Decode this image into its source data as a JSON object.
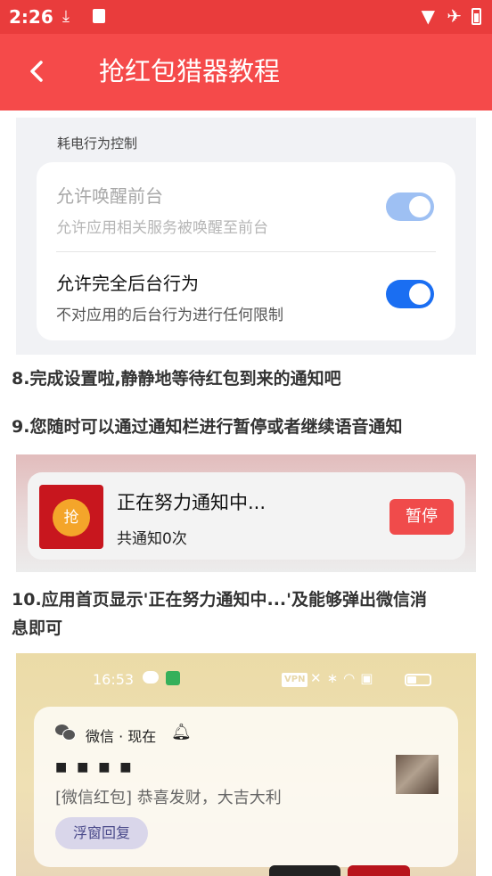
{
  "status_bar": {
    "time": "2:26"
  },
  "app_bar": {
    "title": "抢红包猎器教程"
  },
  "settings_shot": {
    "section_label": "耗电行为控制",
    "rows": [
      {
        "title": "允许唤醒前台",
        "subtitle": "允许应用相关服务被唤醒至前台",
        "enabled": true,
        "dimmed": true
      },
      {
        "title": "允许完全后台行为",
        "subtitle": "不对应用的后台行为进行任何限制",
        "enabled": true,
        "dimmed": false
      }
    ]
  },
  "steps": {
    "s8": "8.完成设置啦,静静地等待红包到来的通知吧",
    "s9": "9.您随时可以通过通知栏进行暂停或者继续语音通知",
    "s10_line1": "10.应用首页显示'正在努力通知中...'及能够弹出微信消",
    "s10_line2": "息即可"
  },
  "notification_shot": {
    "envelope_char": "抢",
    "title": "正在努力通知中...",
    "subtitle": "共通知0次",
    "pause_button": "暂停"
  },
  "wechat_shot": {
    "status_time": "16:53",
    "vpn": "VPN",
    "app_line": "微信 · 现在",
    "sender_masked": "■ ■  ■ ■",
    "message": "[微信红包] 恭喜发财，大吉大利",
    "reply_button": "浮窗回复"
  },
  "colors": {
    "status_bar": "#e93c3c",
    "app_bar": "#f54a4a",
    "toggle_on": "#1a6ef2",
    "pause": "#f04b4b"
  }
}
